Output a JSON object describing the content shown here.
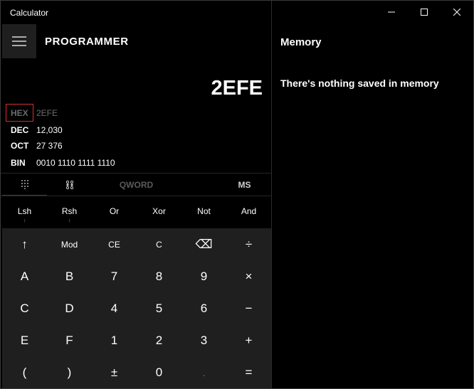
{
  "window": {
    "title": "Calculator"
  },
  "header": {
    "mode_title": "PROGRAMMER"
  },
  "display": {
    "value": "2EFE"
  },
  "radix": [
    {
      "label": "HEX",
      "value": "2EFE",
      "selected": true
    },
    {
      "label": "DEC",
      "value": "12,030",
      "selected": false
    },
    {
      "label": "OCT",
      "value": "27 376",
      "selected": false
    },
    {
      "label": "BIN",
      "value": "0010 1110 1111 1110",
      "selected": false
    }
  ],
  "toolbar": {
    "word_size": "QWORD",
    "memory_store": "MS"
  },
  "bitops": [
    {
      "label": "Lsh",
      "has_arrow": true
    },
    {
      "label": "Rsh",
      "has_arrow": true
    },
    {
      "label": "Or",
      "has_arrow": false
    },
    {
      "label": "Xor",
      "has_arrow": false
    },
    {
      "label": "Not",
      "has_arrow": false
    },
    {
      "label": "And",
      "has_arrow": false
    }
  ],
  "keypad": {
    "row1": [
      "↑",
      "Mod",
      "CE",
      "C",
      "⌫",
      "÷"
    ],
    "row2": [
      "A",
      "B",
      "7",
      "8",
      "9",
      "×"
    ],
    "row3": [
      "C",
      "D",
      "4",
      "5",
      "6",
      "−"
    ],
    "row4": [
      "E",
      "F",
      "1",
      "2",
      "3",
      "+"
    ],
    "row5": [
      "(",
      ")",
      "±",
      "0",
      ".",
      "="
    ]
  },
  "memory": {
    "title": "Memory",
    "empty_message": "There's nothing saved in memory"
  },
  "colors": {
    "background": "#000000",
    "keypad_bg": "#1f1f1f",
    "selected_box": "#d0312d",
    "disabled_text": "#5a5a5a"
  }
}
